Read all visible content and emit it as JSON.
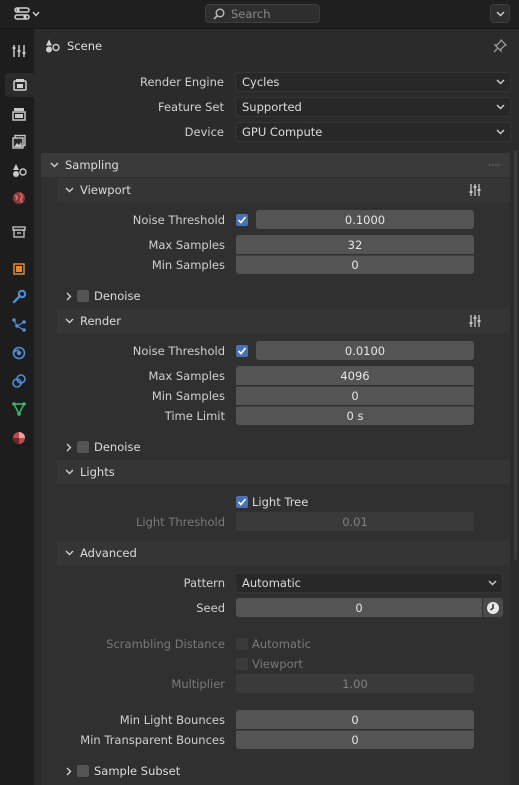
{
  "header": {
    "search_placeholder": "Search"
  },
  "sidebar": {
    "tabs": [
      {
        "icon": "tool-icon"
      },
      {
        "icon": "render-icon",
        "active": true
      },
      {
        "icon": "output-icon"
      },
      {
        "icon": "view-layer-icon"
      },
      {
        "icon": "scene-icon"
      },
      {
        "icon": "world-icon"
      },
      {
        "icon": "collection-icon"
      },
      {
        "icon": "object-icon"
      },
      {
        "icon": "modifier-icon"
      },
      {
        "icon": "particles-icon"
      },
      {
        "icon": "physics-icon"
      },
      {
        "icon": "constraints-icon"
      },
      {
        "icon": "object-data-icon"
      },
      {
        "icon": "material-icon"
      }
    ]
  },
  "context": {
    "title": "Scene"
  },
  "render": {
    "engine_label": "Render Engine",
    "engine_value": "Cycles",
    "feature_label": "Feature Set",
    "feature_value": "Supported",
    "device_label": "Device",
    "device_value": "GPU Compute"
  },
  "sampling": {
    "title": "Sampling",
    "viewport": {
      "title": "Viewport",
      "noise_label": "Noise Threshold",
      "noise_value": "0.1000",
      "max_label": "Max Samples",
      "max_value": "32",
      "min_label": "Min Samples",
      "min_value": "0",
      "denoise_label": "Denoise"
    },
    "render": {
      "title": "Render",
      "noise_label": "Noise Threshold",
      "noise_value": "0.0100",
      "max_label": "Max Samples",
      "max_value": "4096",
      "min_label": "Min Samples",
      "min_value": "0",
      "time_label": "Time Limit",
      "time_value": "0 s",
      "denoise_label": "Denoise"
    },
    "lights": {
      "title": "Lights",
      "tree_label": "Light Tree",
      "threshold_label": "Light Threshold",
      "threshold_value": "0.01"
    },
    "advanced": {
      "title": "Advanced",
      "pattern_label": "Pattern",
      "pattern_value": "Automatic",
      "seed_label": "Seed",
      "seed_value": "0",
      "scrambling_label": "Scrambling Distance",
      "automatic_label": "Automatic",
      "viewport_label": "Viewport",
      "multiplier_label": "Multiplier",
      "multiplier_value": "1.00",
      "min_light_label": "Min Light Bounces",
      "min_light_value": "0",
      "min_transp_label": "Min Transparent Bounces",
      "min_transp_value": "0"
    },
    "subset_label": "Sample Subset"
  }
}
